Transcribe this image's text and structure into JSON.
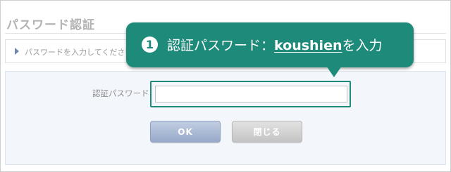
{
  "dialog": {
    "title": "パスワード認証",
    "notice": "パスワードを入力してください",
    "field_label": "認証パスワード",
    "password_value": "",
    "password_placeholder": "",
    "ok_label": "OK",
    "close_label": "閉じる"
  },
  "callout": {
    "step": "1",
    "prefix": "認証パスワード：",
    "password": "koushien",
    "suffix": "を入力"
  },
  "colors": {
    "callout": "#1e8a7a",
    "ok_button": "#a6b6d2",
    "close_button": "#cfcfcf",
    "form_panel": "#f3f6fb"
  }
}
